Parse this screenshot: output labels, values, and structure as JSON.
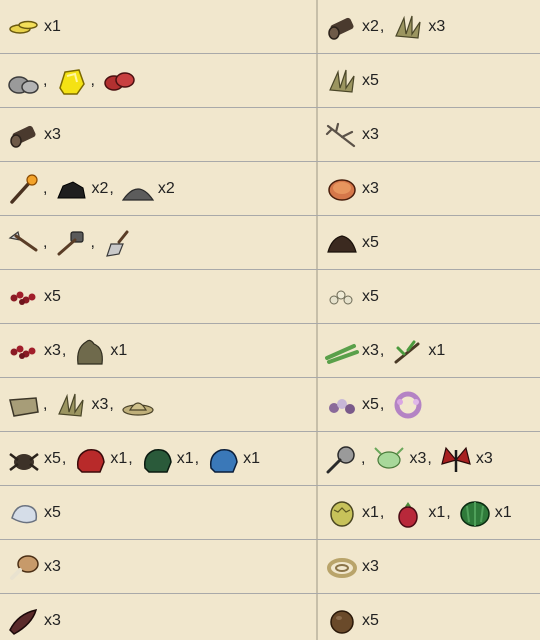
{
  "rows": [
    {
      "left": [
        {
          "icon": "gold-nugget-icon",
          "qty": "x1"
        }
      ],
      "right": [
        {
          "icon": "log-icon",
          "qty": "x2"
        },
        {
          "icon": "cut-grass-icon",
          "qty": "x3"
        }
      ]
    },
    {
      "left": [
        {
          "icon": "rocks-icon",
          "qty": ""
        },
        {
          "icon": "gold-icon",
          "qty": ""
        },
        {
          "icon": "red-gem-icon",
          "qty": ""
        }
      ],
      "right": [
        {
          "icon": "cut-grass-icon",
          "qty": "x5"
        }
      ]
    },
    {
      "left": [
        {
          "icon": "log-icon",
          "qty": "x3"
        }
      ],
      "right": [
        {
          "icon": "twigs-icon",
          "qty": "x3"
        }
      ]
    },
    {
      "left": [
        {
          "icon": "torch-icon",
          "qty": ""
        },
        {
          "icon": "charcoal-icon",
          "qty": "x2"
        },
        {
          "icon": "ash-icon",
          "qty": "x2"
        }
      ],
      "right": [
        {
          "icon": "meat-icon",
          "qty": "x3"
        }
      ]
    },
    {
      "left": [
        {
          "icon": "axe-icon",
          "qty": ""
        },
        {
          "icon": "hammer-icon",
          "qty": ""
        },
        {
          "icon": "shovel-icon",
          "qty": ""
        }
      ],
      "right": [
        {
          "icon": "manure-icon",
          "qty": "x5"
        }
      ]
    },
    {
      "left": [
        {
          "icon": "berries-icon",
          "qty": "x5"
        }
      ],
      "right": [
        {
          "icon": "seeds-icon",
          "qty": "x5"
        }
      ]
    },
    {
      "left": [
        {
          "icon": "berries-icon",
          "qty": "x3"
        },
        {
          "icon": "berry-bush-icon",
          "qty": "x1"
        }
      ],
      "right": [
        {
          "icon": "reeds-icon",
          "qty": "x3"
        },
        {
          "icon": "sapling-icon",
          "qty": "x1"
        }
      ]
    },
    {
      "left": [
        {
          "icon": "bedroll-icon",
          "qty": ""
        },
        {
          "icon": "cut-grass-icon",
          "qty": "x3"
        },
        {
          "icon": "straw-hat-icon",
          "qty": ""
        }
      ],
      "right": [
        {
          "icon": "petals-icon",
          "qty": "x5"
        },
        {
          "icon": "flower-garland-icon",
          "qty": ""
        }
      ]
    },
    {
      "left": [
        {
          "icon": "spider-icon",
          "qty": "x5"
        },
        {
          "icon": "red-bag-icon",
          "qty": "x1"
        },
        {
          "icon": "green-bag-icon",
          "qty": "x1"
        },
        {
          "icon": "blue-bag-icon",
          "qty": "x1"
        }
      ],
      "right": [
        {
          "icon": "bug-net-icon",
          "qty": ""
        },
        {
          "icon": "glow-bug-icon",
          "qty": "x3"
        },
        {
          "icon": "butterfly-icon",
          "qty": "x3"
        }
      ]
    },
    {
      "left": [
        {
          "icon": "silk-icon",
          "qty": "x5"
        }
      ],
      "right": [
        {
          "icon": "durian-icon",
          "qty": "x1"
        },
        {
          "icon": "dragonfruit-icon",
          "qty": "x1"
        },
        {
          "icon": "watermelon-icon",
          "qty": "x1"
        }
      ]
    },
    {
      "left": [
        {
          "icon": "drumstick-icon",
          "qty": "x3"
        }
      ],
      "right": [
        {
          "icon": "rope-icon",
          "qty": "x3"
        }
      ]
    },
    {
      "left": [
        {
          "icon": "jerky-icon",
          "qty": "x3"
        }
      ],
      "right": [
        {
          "icon": "coconut-icon",
          "qty": "x5"
        }
      ]
    }
  ]
}
